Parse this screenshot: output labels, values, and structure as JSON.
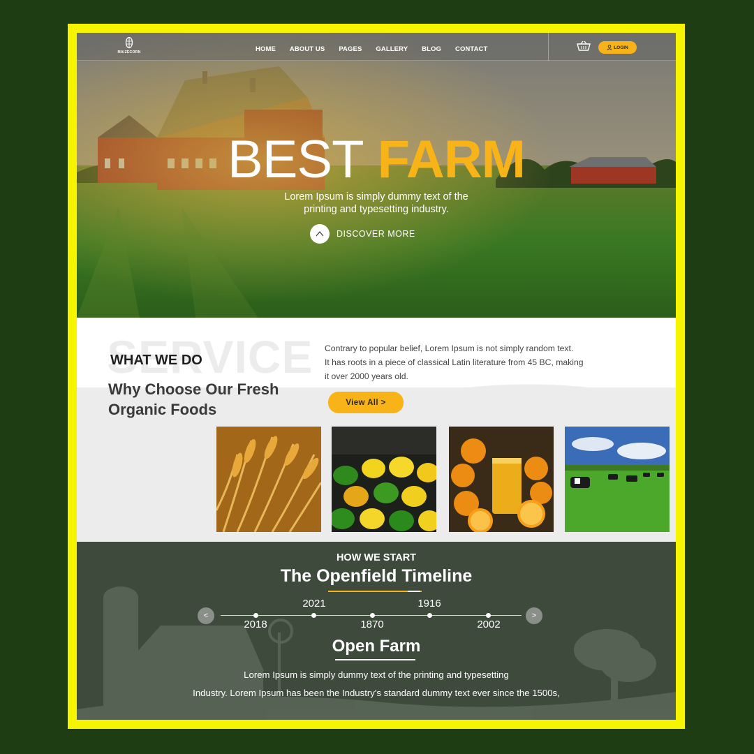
{
  "header": {
    "logo_text": "MAIZECORN",
    "nav": [
      "HOME",
      "ABOUT US",
      "PAGES",
      "GALLERY",
      "BLOG",
      "CONTACT"
    ],
    "login_label": "LOGIN"
  },
  "hero": {
    "title_part1": "BEST",
    "title_part2": "FARM",
    "subtitle_line1": "Lorem Ipsum is simply dummy text of the",
    "subtitle_line2": "printing and typesetting industry.",
    "cta_label": "DISCOVER MORE"
  },
  "service": {
    "watermark": "SERVICE",
    "kicker": "WHAT WE DO",
    "title_line1": "Why Choose Our Fresh",
    "title_line2": "Organic Foods",
    "text_line1": "Contrary to popular belief, Lorem Ipsum is not simply random text.",
    "text_line2": "It has roots in a piece of classical Latin literature from 45 BC, making",
    "text_line3": "it over 2000 years old.",
    "button_label": "View All >",
    "images": [
      "wheat",
      "peppers",
      "oranges-juice",
      "cows-pasture"
    ]
  },
  "timeline": {
    "kicker": "HOW WE START",
    "title": "The Openfield Timeline",
    "years_top": [
      "2021",
      "1916"
    ],
    "years_bottom": [
      "2018",
      "1870",
      "2002"
    ],
    "prev_label": "<",
    "next_label": ">",
    "subtitle": "Open Farm",
    "text_line1": "Lorem Ipsum is simply dummy text of the printing and typesetting",
    "text_line2": "Industry. Lorem Ipsum has been the Industry's standard dummy text ever since the 1500s,"
  },
  "colors": {
    "accent": "#f8b318",
    "frame": "#f7f400",
    "background": "#1e3d12",
    "timeline_bg": "#3d4a3c"
  }
}
